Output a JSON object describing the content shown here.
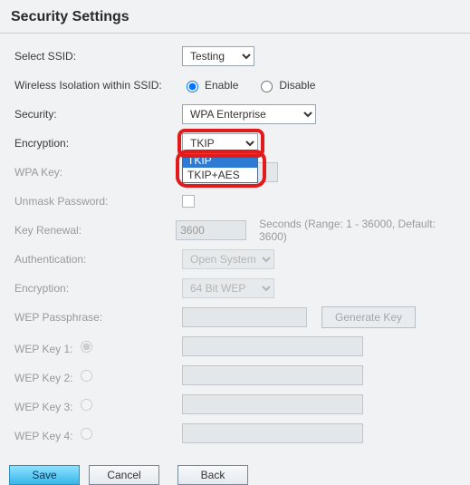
{
  "title": "Security Settings",
  "ssid": {
    "label": "Select SSID:",
    "value": "Testing"
  },
  "isolation": {
    "label": "Wireless Isolation within SSID:",
    "enable": "Enable",
    "disable": "Disable"
  },
  "security": {
    "label": "Security:",
    "value": "WPA Enterprise"
  },
  "encryption": {
    "label": "Encryption:",
    "value": "TKIP",
    "opt1": "TKIP",
    "opt2": "TKIP+AES"
  },
  "wpa_key": {
    "label": "WPA Key:",
    "value": ""
  },
  "unmask": {
    "label": "Unmask Password:"
  },
  "key_renewal": {
    "label": "Key Renewal:",
    "value": "3600",
    "hint": "Seconds (Range: 1 - 36000, Default: 3600)"
  },
  "auth": {
    "label": "Authentication:",
    "value": "Open System"
  },
  "wep_enc": {
    "label": "Encryption:",
    "value": "64 Bit WEP"
  },
  "wep_pass": {
    "label": "WEP Passphrase:",
    "value": "",
    "button": "Generate Key"
  },
  "wep1": {
    "label": "WEP Key 1:",
    "value": ""
  },
  "wep2": {
    "label": "WEP Key 2:",
    "value": ""
  },
  "wep3": {
    "label": "WEP Key 3:",
    "value": ""
  },
  "wep4": {
    "label": "WEP Key 4:",
    "value": ""
  },
  "buttons": {
    "save": "Save",
    "cancel": "Cancel",
    "back": "Back"
  }
}
